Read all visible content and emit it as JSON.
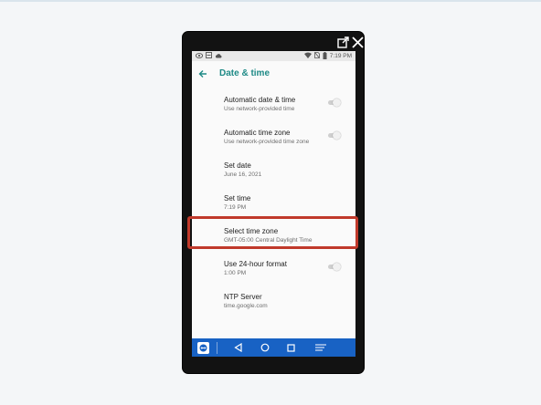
{
  "statusbar": {
    "time": "7:19 PM"
  },
  "appbar": {
    "title": "Date & time"
  },
  "settings": [
    {
      "title": "Automatic date & time",
      "subtitle": "Use network-provided time",
      "toggle": "off"
    },
    {
      "title": "Automatic time zone",
      "subtitle": "Use network-provided time zone",
      "toggle": "off"
    },
    {
      "title": "Set date",
      "subtitle": "June 16, 2021"
    },
    {
      "title": "Set time",
      "subtitle": "7:19 PM"
    },
    {
      "title": "Select time zone",
      "subtitle": "GMT-05:00 Central Daylight Time"
    },
    {
      "title": "Use 24-hour format",
      "subtitle": "1:00 PM",
      "toggle": "off"
    },
    {
      "title": "NTP Server",
      "subtitle": "time.google.com"
    }
  ],
  "colors": {
    "accent": "#1e8a86",
    "navbar": "#1862c4",
    "highlight": "#c0392b"
  },
  "icons": {
    "top_controls": [
      "external-link-icon",
      "close-icon"
    ],
    "statusbar_left": [
      "eye-icon",
      "teamviewer-icon",
      "cloud-icon"
    ],
    "statusbar_right": [
      "wifi-icon",
      "no-sim-icon",
      "battery-icon"
    ],
    "navbar": [
      "teamviewer-icon",
      "back-icon",
      "home-icon",
      "recents-icon",
      "menu-icon"
    ]
  }
}
